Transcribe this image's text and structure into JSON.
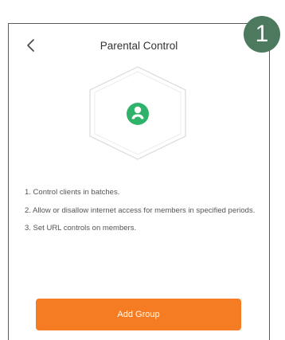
{
  "step_badge": "1",
  "header": {
    "back_icon": "chevron-left-icon",
    "title": "Parental Control"
  },
  "illustration": {
    "icon": "user-group-icon",
    "accent_color": "#2fb36a"
  },
  "features": [
    "1. Control clients in batches.",
    "2. Allow or disallow internet access for members in specified periods.",
    "3. Set URL controls on members."
  ],
  "primary_button": {
    "label": "Add Group",
    "color": "#f57c22"
  }
}
